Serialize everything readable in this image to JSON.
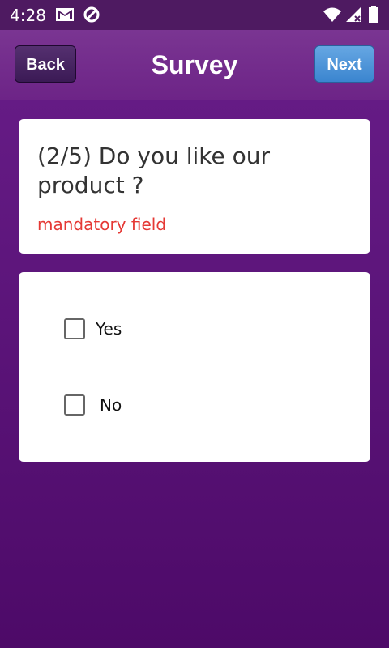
{
  "status_bar": {
    "time": "4:28",
    "left_icons": [
      "gmail-icon",
      "sync-icon"
    ],
    "right_icons": [
      "wifi-icon",
      "signal-icon",
      "battery-icon"
    ]
  },
  "header": {
    "back_label": "Back",
    "title": "Survey",
    "next_label": "Next"
  },
  "question": {
    "text": "(2/5) Do you like our product ?",
    "mandatory_label": "mandatory field"
  },
  "answers": {
    "options": [
      {
        "label": "Yes",
        "checked": false
      },
      {
        "label": "No",
        "checked": false
      }
    ]
  },
  "colors": {
    "background": "#5a1475",
    "header": "#6d2487",
    "back_button": "#3b1a55",
    "next_button": "#3b85cf",
    "mandatory_text": "#e53935"
  }
}
